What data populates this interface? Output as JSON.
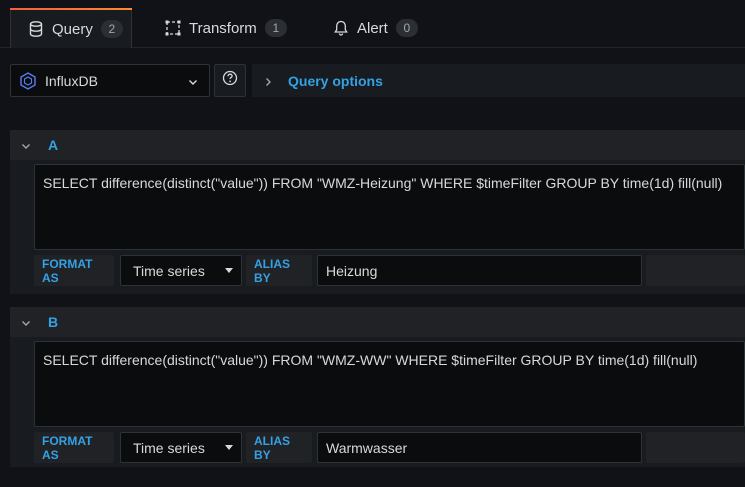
{
  "tabs": [
    {
      "label": "Query",
      "count": "2",
      "icon": "database-icon",
      "active": true
    },
    {
      "label": "Transform",
      "count": "1",
      "icon": "transform-icon",
      "active": false
    },
    {
      "label": "Alert",
      "count": "0",
      "icon": "bell-icon",
      "active": false
    }
  ],
  "datasource": {
    "name": "InfluxDB",
    "icon": "influxdb-icon"
  },
  "query_options_label": "Query options",
  "queries": [
    {
      "ref": "A",
      "text": "SELECT difference(distinct(\"value\")) FROM \"WMZ-Heizung\" WHERE $timeFilter GROUP BY time(1d) fill(null)",
      "format_label": "FORMAT AS",
      "format_value": "Time series",
      "alias_label": "ALIAS BY",
      "alias_value": "Heizung"
    },
    {
      "ref": "B",
      "text": "SELECT difference(distinct(\"value\")) FROM \"WMZ-WW\" WHERE $timeFilter GROUP BY time(1d) fill(null)",
      "format_label": "FORMAT AS",
      "format_value": "Time series",
      "alias_label": "ALIAS BY",
      "alias_value": "Warmwasser"
    }
  ],
  "colors": {
    "accent": "#33a2e5",
    "tab_highlight": "#f55f3e",
    "background": "#111217"
  }
}
